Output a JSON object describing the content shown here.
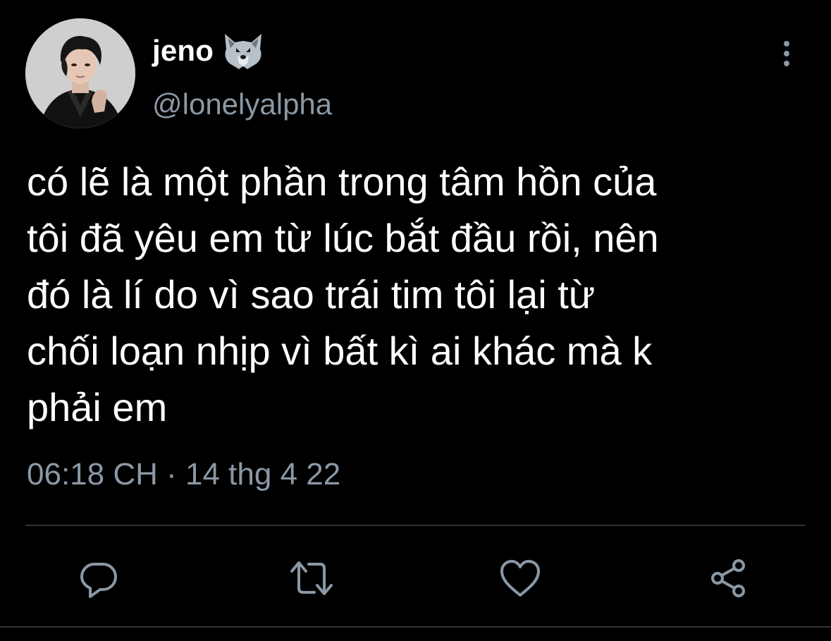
{
  "user": {
    "display_name": "jeno",
    "name_emoji": "wolf-emoji",
    "handle": "@lonelyalpha",
    "avatar": "profile-photo"
  },
  "tweet": {
    "text": "có lẽ là một phần trong tâm hồn của\ntôi đã yêu em từ lúc bắt đầu rồi, nên\nđó là lí do vì sao trái tim tôi lại từ\nchối loạn nhịp vì bất kì ai khác mà k\nphải em",
    "time": "06:18 CH",
    "separator": "·",
    "date": "14 thg 4 22"
  },
  "actions": {
    "reply": "reply-icon",
    "retweet": "retweet-icon",
    "like": "heart-icon",
    "share": "share-icon"
  },
  "menu": {
    "icon": "more-vertical-icon"
  },
  "colors": {
    "background": "#000000",
    "text_primary": "#ffffff",
    "text_secondary": "#8b98a5",
    "divider": "#2f3336"
  }
}
